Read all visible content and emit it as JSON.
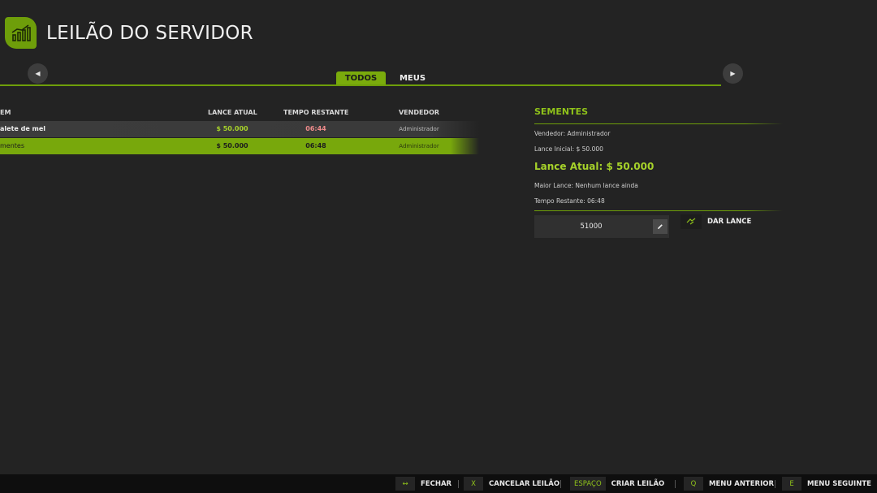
{
  "header": {
    "title": "LEILÃO DO SERVIDOR",
    "logo_icon": "chart-bars-icon"
  },
  "tabs": [
    {
      "label": "TODOS",
      "active": true
    },
    {
      "label": "MEUS",
      "active": false
    }
  ],
  "table": {
    "columns": [
      "EM",
      "LANCE ATUAL",
      "TEMPO RESTANTE",
      "VENDEDOR"
    ],
    "rows": [
      {
        "item": "alete de mel",
        "price": "$ 50.000",
        "time": "06:44",
        "seller": "Administrador",
        "selected": false
      },
      {
        "item": "mentes",
        "price": "$ 50.000",
        "time": "06:48",
        "seller": "Administrador",
        "selected": true
      }
    ]
  },
  "detail": {
    "title": "SEMENTES",
    "seller": "Vendedor: Administrador",
    "start_bid": "Lance Inicial: $ 50.000",
    "current_bid": "Lance Atual: $ 50.000",
    "highest_bid": "Maior Lance: Nenhum lance ainda",
    "time_left": "Tempo Restante: 06:48",
    "bid_value": "51000",
    "bid_button": "DAR LANCE"
  },
  "footer": [
    {
      "key": "↔",
      "label": "FECHAR"
    },
    {
      "key": "X",
      "label": "CANCELAR LEILÃO"
    },
    {
      "key": "ESPAÇO",
      "label": "CRIAR LEILÃO"
    },
    {
      "key": "Q",
      "label": "MENU ANTERIOR"
    },
    {
      "key": "E",
      "label": "MENU SEGUINTE"
    }
  ],
  "colors": {
    "accent": "#7aab0c",
    "background": "#232323",
    "time_warning": "#f08c8c"
  }
}
